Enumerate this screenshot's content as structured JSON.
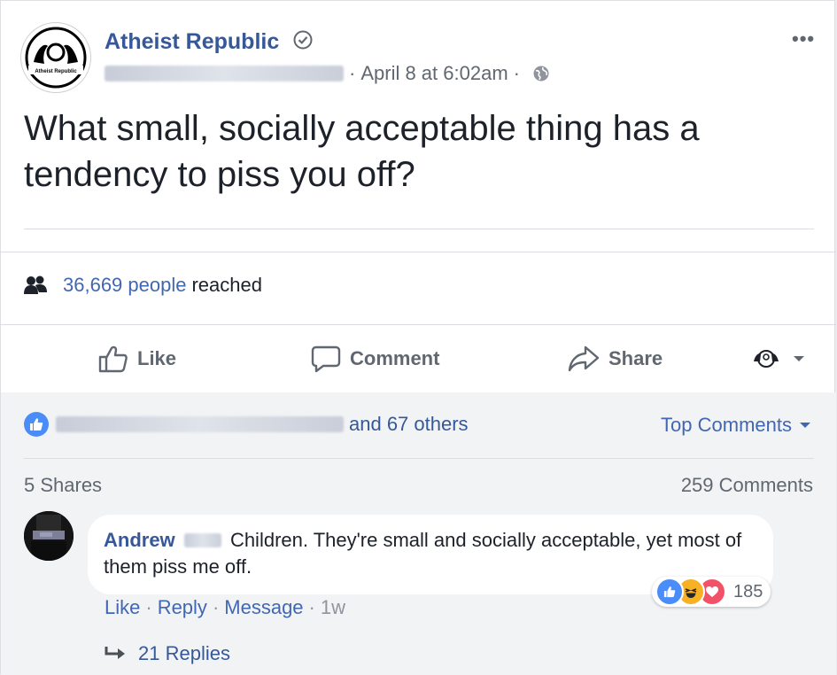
{
  "post": {
    "page_name": "Atheist Republic",
    "avatar_text": "Atheist Republic",
    "date": "April 8 at 6:02am",
    "text": "What small, socially acceptable thing has a tendency to piss you off?"
  },
  "reach": {
    "count_label": "36,669 people",
    "suffix": "reached"
  },
  "actions": {
    "like": "Like",
    "comment": "Comment",
    "share": "Share"
  },
  "reactions": {
    "others_label": "and 67 others"
  },
  "sort": {
    "label": "Top Comments"
  },
  "counts": {
    "shares": "5 Shares",
    "comments": "259 Comments"
  },
  "comment": {
    "author": "Andrew",
    "text": "Children. They're small and socially acceptable, yet most of them piss me off.",
    "like": "Like",
    "reply": "Reply",
    "message": "Message",
    "time": "1w",
    "reaction_count": "185",
    "replies": "21 Replies"
  },
  "colors": {
    "link_blue": "#365899",
    "accent_blue": "#4267b2",
    "haha_yellow": "#f7b125",
    "love_red": "#f25268"
  }
}
